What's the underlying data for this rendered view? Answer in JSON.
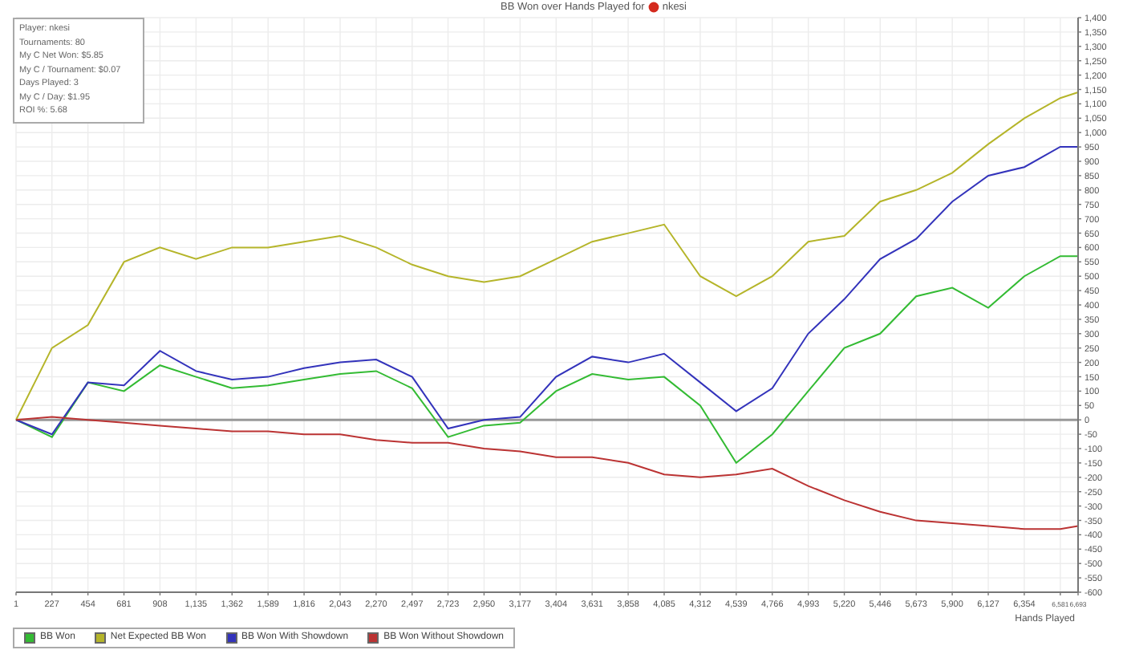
{
  "title": {
    "text": "BB Won over Hands Played for",
    "player": "nkesi"
  },
  "stats_box": {
    "lines": [
      "Player: nkesi",
      "Tournaments: 80",
      "My C Net Won: $5.85",
      "My C / Tournament: $0.07",
      "Days Played: 3",
      "My C / Day: $1.95",
      "ROI %: 5.68"
    ]
  },
  "chart": {
    "chart_data": {
      "type": "line",
      "grid": true,
      "xlabel": "Hands Played",
      "x": [
        1,
        227,
        454,
        681,
        908,
        1135,
        1362,
        1589,
        1816,
        2043,
        2270,
        2497,
        2723,
        2950,
        3177,
        3404,
        3631,
        3858,
        4085,
        4312,
        4539,
        4766,
        4993,
        5220,
        5446,
        5673,
        5900,
        6127,
        6354,
        6581,
        6693
      ],
      "series": [
        {
          "name": "BB Won",
          "color": "#33bb33",
          "values": [
            0,
            -60,
            130,
            100,
            190,
            150,
            110,
            120,
            140,
            160,
            170,
            110,
            -60,
            -20,
            -10,
            100,
            160,
            140,
            150,
            50,
            -150,
            -50,
            100,
            250,
            300,
            430,
            460,
            390,
            500,
            570,
            570
          ]
        },
        {
          "name": "Net Expected BB Won",
          "color": "#b5b52a",
          "values": [
            0,
            250,
            330,
            550,
            600,
            560,
            600,
            600,
            620,
            640,
            600,
            540,
            500,
            480,
            500,
            560,
            620,
            650,
            680,
            500,
            430,
            500,
            620,
            640,
            760,
            800,
            860,
            960,
            1050,
            1120,
            1140
          ]
        },
        {
          "name": "BB Won With Showdown",
          "color": "#3333bb",
          "values": [
            0,
            -50,
            130,
            120,
            240,
            170,
            140,
            150,
            180,
            200,
            210,
            150,
            -30,
            0,
            10,
            150,
            220,
            200,
            230,
            130,
            30,
            110,
            300,
            420,
            560,
            630,
            760,
            850,
            880,
            950,
            950
          ]
        },
        {
          "name": "BB Won Without Showdown",
          "color": "#bb3333",
          "values": [
            0,
            10,
            0,
            -10,
            -20,
            -30,
            -40,
            -40,
            -50,
            -50,
            -70,
            -80,
            -80,
            -100,
            -110,
            -130,
            -130,
            -150,
            -190,
            -200,
            -190,
            -170,
            -230,
            -280,
            -320,
            -350,
            -360,
            -370,
            -380,
            -380,
            -370
          ]
        }
      ],
      "xlim": [
        1,
        6693
      ],
      "ylim": [
        -600,
        1400
      ],
      "xticks": [
        1,
        227,
        454,
        681,
        908,
        {
          "value": 1135,
          "label": "1,135"
        },
        {
          "value": 1362,
          "label": "1,362"
        },
        {
          "value": 1589,
          "label": "1,589"
        },
        {
          "value": 1816,
          "label": "1,816"
        },
        {
          "value": 2043,
          "label": "2,043"
        },
        {
          "value": 2270,
          "label": "2,270"
        },
        {
          "value": 2497,
          "label": "2,497"
        },
        {
          "value": 2723,
          "label": "2,723"
        },
        {
          "value": 2950,
          "label": "2,950"
        },
        {
          "value": 3177,
          "label": "3,177"
        },
        {
          "value": 3404,
          "label": "3,404"
        },
        {
          "value": 3631,
          "label": "3,631"
        },
        {
          "value": 3858,
          "label": "3,858"
        },
        {
          "value": 4085,
          "label": "4,085"
        },
        {
          "value": 4312,
          "label": "4,312"
        },
        {
          "value": 4539,
          "label": "4,539"
        },
        {
          "value": 4766,
          "label": "4,766"
        },
        {
          "value": 4993,
          "label": "4,993"
        },
        {
          "value": 5220,
          "label": "5,220"
        },
        {
          "value": 5446,
          "label": "5,446"
        },
        {
          "value": 5673,
          "label": "5,673"
        },
        {
          "value": 5900,
          "label": "5,900"
        },
        {
          "value": 6127,
          "label": "6,127"
        },
        {
          "value": 6354,
          "label": "6,354"
        },
        {
          "value": 6581,
          "label": "6,581"
        },
        {
          "value": 6693,
          "label": "6,693"
        }
      ],
      "yticks": [
        {
          "value": 1400,
          "label": "1,400"
        },
        {
          "value": 1350,
          "label": "1,350"
        },
        {
          "value": 1300,
          "label": "1,300"
        },
        {
          "value": 1250,
          "label": "1,250"
        },
        {
          "value": 1200,
          "label": "1,200"
        },
        {
          "value": 1150,
          "label": "1,150"
        },
        {
          "value": 1100,
          "label": "1,100"
        },
        {
          "value": 1050,
          "label": "1,050"
        },
        {
          "value": 1000,
          "label": "1,000"
        },
        950,
        900,
        850,
        800,
        750,
        700,
        650,
        600,
        550,
        500,
        450,
        400,
        350,
        300,
        250,
        200,
        150,
        100,
        50,
        0,
        -50,
        -100,
        -150,
        -200,
        -250,
        -300,
        -350,
        -400,
        -450,
        -500,
        -550,
        -600
      ]
    }
  }
}
